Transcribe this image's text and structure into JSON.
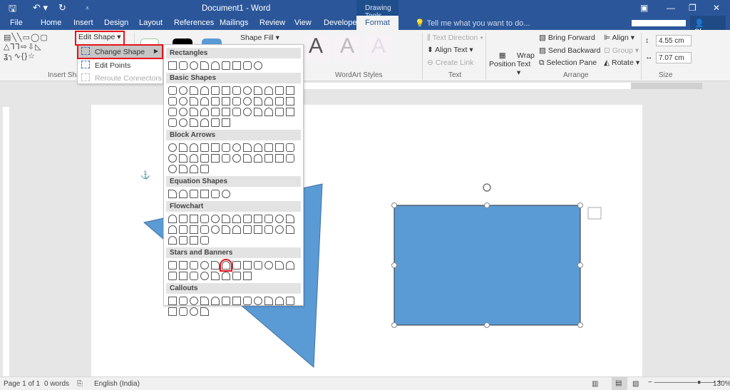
{
  "titlebar": {
    "title": "Document1 - Word",
    "context": "Drawing Tools"
  },
  "tabs": [
    "File",
    "Home",
    "Insert",
    "Design",
    "Layout",
    "References",
    "Mailings",
    "Review",
    "View",
    "Developer",
    "Format"
  ],
  "tell_me": "Tell me what you want to do...",
  "share": "Share",
  "ribbon": {
    "edit_shape": "Edit Shape ▾",
    "insert_shapes": "Insert Shapes",
    "shape_fill": "Shape Fill ▾",
    "wordart_styles": "WordArt Styles",
    "text_direction": "Text Direction ▾",
    "align_text": "Align Text ▾",
    "create_link": "Create Link",
    "text_group": "Text",
    "position": "Position",
    "wrap_text": "Wrap Text ▾",
    "bring_forward": "Bring Forward",
    "send_backward": "Send Backward",
    "selection_pane": "Selection Pane",
    "align": "Align ▾",
    "group": "Group ▾",
    "rotate": "Rotate ▾",
    "arrange": "Arrange",
    "height": "4.55 cm",
    "width": "7.07 cm",
    "size": "Size"
  },
  "edit_menu": {
    "change_shape": "Change Shape",
    "edit_points": "Edit Points",
    "reroute": "Reroute Connectors"
  },
  "gallery": [
    {
      "title": "Rectangles",
      "count": 9
    },
    {
      "title": "Basic Shapes",
      "count": 42
    },
    {
      "title": "Block Arrows",
      "count": 28
    },
    {
      "title": "Equation Shapes",
      "count": 6
    },
    {
      "title": "Flowchart",
      "count": 28
    },
    {
      "title": "Stars and Banners",
      "count": 20,
      "selected": 5
    },
    {
      "title": "Callouts",
      "count": 16
    }
  ],
  "status": {
    "page": "Page 1 of 1",
    "words": "0 words",
    "language": "English (India)",
    "zoom": "130%"
  },
  "colors": {
    "shape": "#5b9bd5",
    "accent": "#2b579a"
  }
}
